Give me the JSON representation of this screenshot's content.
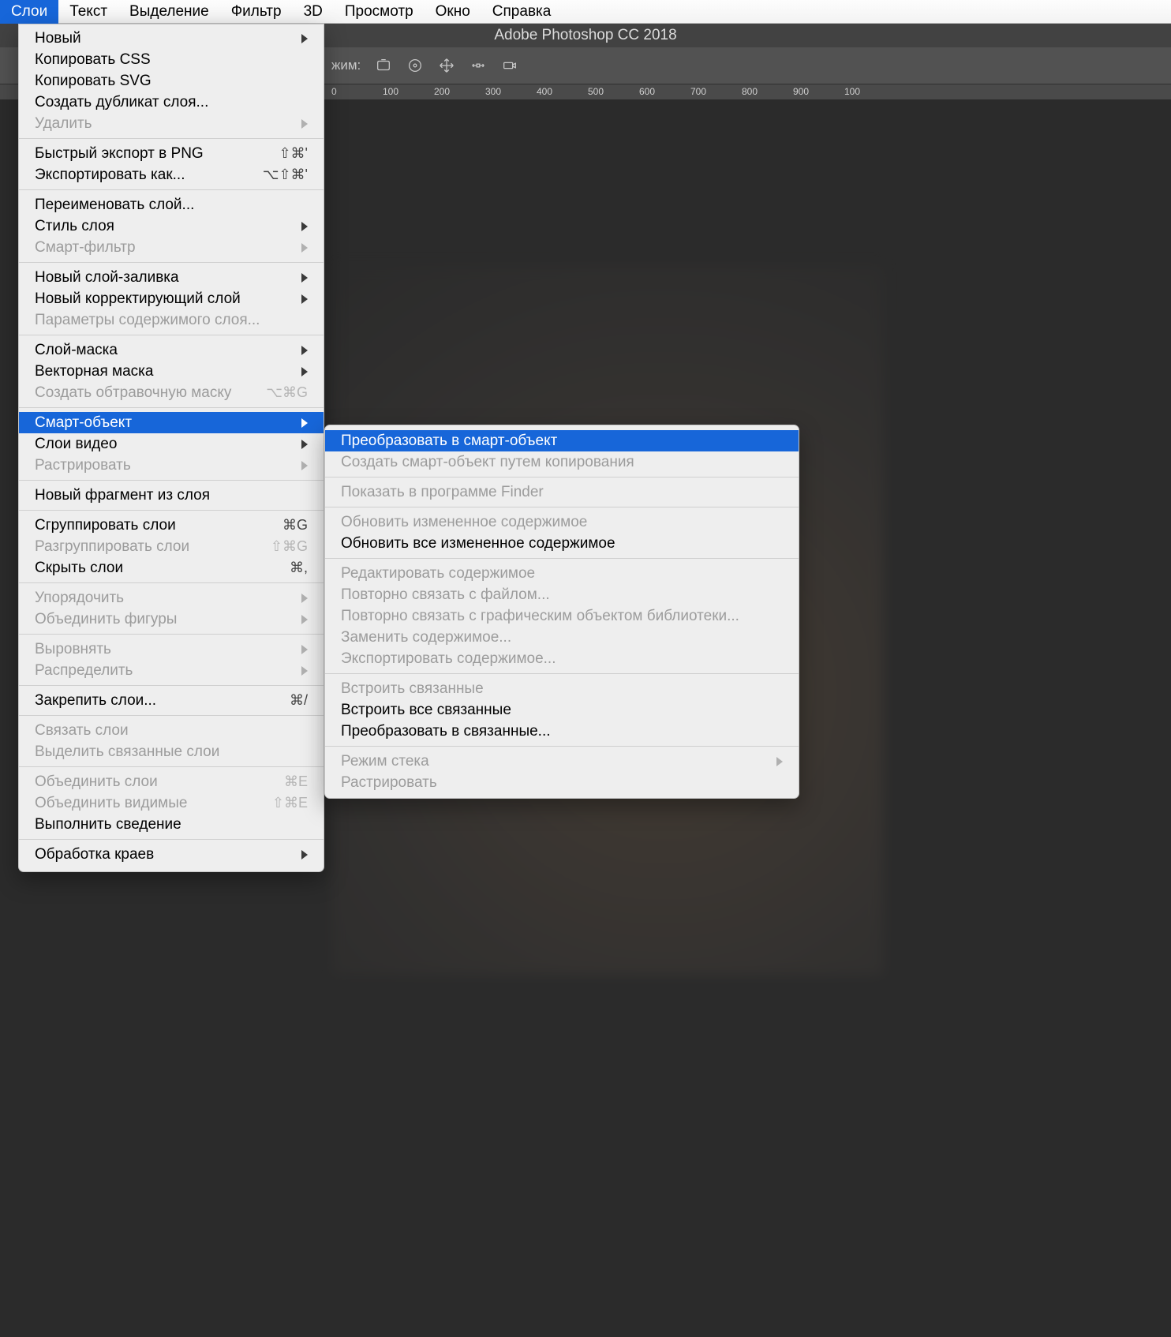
{
  "app_title": "Adobe Photoshop CC 2018",
  "menubar": {
    "items": [
      "Слои",
      "Текст",
      "Выделение",
      "Фильтр",
      "3D",
      "Просмотр",
      "Окно",
      "Справка"
    ],
    "active_index": 0
  },
  "optionsbar": {
    "label": "жим:"
  },
  "ruler": {
    "ticks": [
      "0",
      "100",
      "200",
      "300",
      "400",
      "500",
      "600",
      "700",
      "800",
      "900",
      "100"
    ]
  },
  "menu": {
    "groups": [
      [
        {
          "label": "Новый",
          "arrow": true
        },
        {
          "label": "Копировать CSS"
        },
        {
          "label": "Копировать SVG"
        },
        {
          "label": "Создать дубликат слоя..."
        },
        {
          "label": "Удалить",
          "arrow": true,
          "disabled": true
        }
      ],
      [
        {
          "label": "Быстрый экспорт в PNG",
          "kbd": "⇧⌘'"
        },
        {
          "label": "Экспортировать как...",
          "kbd": "⌥⇧⌘'"
        }
      ],
      [
        {
          "label": "Переименовать слой..."
        },
        {
          "label": "Стиль слоя",
          "arrow": true
        },
        {
          "label": "Смарт-фильтр",
          "arrow": true,
          "disabled": true
        }
      ],
      [
        {
          "label": "Новый слой-заливка",
          "arrow": true
        },
        {
          "label": "Новый корректирующий слой",
          "arrow": true
        },
        {
          "label": "Параметры содержимого слоя...",
          "disabled": true
        }
      ],
      [
        {
          "label": "Слой-маска",
          "arrow": true
        },
        {
          "label": "Векторная маска",
          "arrow": true
        },
        {
          "label": "Создать обтравочную маску",
          "kbd": "⌥⌘G",
          "disabled": true
        }
      ],
      [
        {
          "label": "Смарт-объект",
          "arrow": true,
          "highlight": true
        },
        {
          "label": "Слои видео",
          "arrow": true
        },
        {
          "label": "Растрировать",
          "arrow": true,
          "disabled": true
        }
      ],
      [
        {
          "label": "Новый фрагмент из слоя"
        }
      ],
      [
        {
          "label": "Сгруппировать слои",
          "kbd": "⌘G"
        },
        {
          "label": "Разгруппировать слои",
          "kbd": "⇧⌘G",
          "disabled": true
        },
        {
          "label": "Скрыть слои",
          "kbd": "⌘,"
        }
      ],
      [
        {
          "label": "Упорядочить",
          "arrow": true,
          "disabled": true
        },
        {
          "label": "Объединить фигуры",
          "arrow": true,
          "disabled": true
        }
      ],
      [
        {
          "label": "Выровнять",
          "arrow": true,
          "disabled": true
        },
        {
          "label": "Распределить",
          "arrow": true,
          "disabled": true
        }
      ],
      [
        {
          "label": "Закрепить слои...",
          "kbd": "⌘/"
        }
      ],
      [
        {
          "label": "Связать слои",
          "disabled": true
        },
        {
          "label": "Выделить связанные слои",
          "disabled": true
        }
      ],
      [
        {
          "label": "Объединить слои",
          "kbd": "⌘E",
          "disabled": true
        },
        {
          "label": "Объединить видимые",
          "kbd": "⇧⌘E",
          "disabled": true
        },
        {
          "label": "Выполнить сведение"
        }
      ],
      [
        {
          "label": "Обработка краев",
          "arrow": true
        }
      ]
    ]
  },
  "submenu": {
    "groups": [
      [
        {
          "label": "Преобразовать в смарт-объект",
          "highlight": true
        },
        {
          "label": "Создать смарт-объект путем копирования",
          "disabled": true
        }
      ],
      [
        {
          "label": "Показать в программе Finder",
          "disabled": true
        }
      ],
      [
        {
          "label": "Обновить измененное содержимое",
          "disabled": true
        },
        {
          "label": "Обновить все измененное содержимое"
        }
      ],
      [
        {
          "label": "Редактировать содержимое",
          "disabled": true
        },
        {
          "label": "Повторно связать с файлом...",
          "disabled": true
        },
        {
          "label": "Повторно связать с графическим объектом библиотеки...",
          "disabled": true
        },
        {
          "label": "Заменить содержимое...",
          "disabled": true
        },
        {
          "label": "Экспортировать содержимое...",
          "disabled": true
        }
      ],
      [
        {
          "label": "Встроить связанные",
          "disabled": true
        },
        {
          "label": "Встроить все связанные"
        },
        {
          "label": "Преобразовать в связанные..."
        }
      ],
      [
        {
          "label": "Режим стека",
          "arrow": true,
          "disabled": true
        },
        {
          "label": "Растрировать",
          "disabled": true
        }
      ]
    ]
  }
}
